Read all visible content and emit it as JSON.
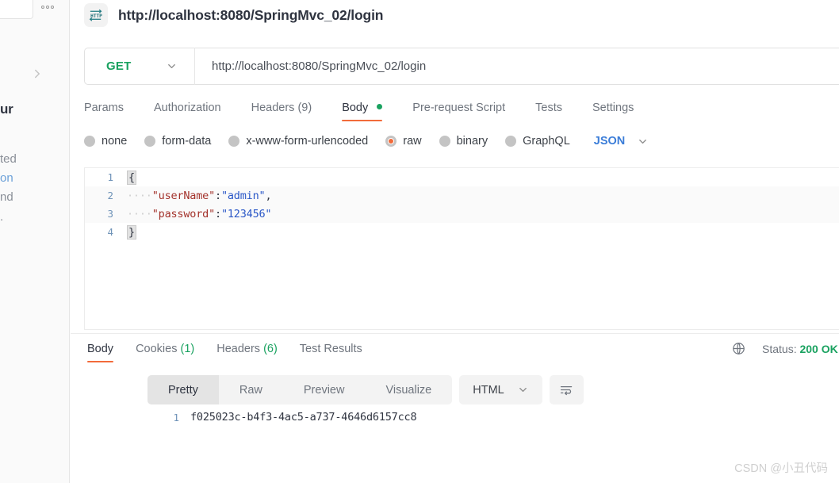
{
  "sidebar": {
    "more_icon": "more-horizontal-icon",
    "expand_icon": "chevron-right-icon",
    "clipped_fragments": {
      "heading": "ur",
      "line1": "ted",
      "line2": "on",
      "line3": "nd",
      "line4": "."
    }
  },
  "request": {
    "icon": "http-protocol-icon",
    "title": "http://localhost:8080/SpringMvc_02/login",
    "method": "GET",
    "url": "http://localhost:8080/SpringMvc_02/login",
    "method_chevron_icon": "chevron-down-icon"
  },
  "request_tabs": [
    {
      "label": "Params",
      "active": false,
      "badge": ""
    },
    {
      "label": "Authorization",
      "active": false,
      "badge": ""
    },
    {
      "label": "Headers",
      "active": false,
      "badge": "(9)"
    },
    {
      "label": "Body",
      "active": true,
      "badge": "",
      "dot": true
    },
    {
      "label": "Pre-request Script",
      "active": false,
      "badge": ""
    },
    {
      "label": "Tests",
      "active": false,
      "badge": ""
    },
    {
      "label": "Settings",
      "active": false,
      "badge": ""
    }
  ],
  "body_types": [
    {
      "label": "none",
      "selected": false
    },
    {
      "label": "form-data",
      "selected": false
    },
    {
      "label": "x-www-form-urlencoded",
      "selected": false
    },
    {
      "label": "raw",
      "selected": true
    },
    {
      "label": "binary",
      "selected": false
    },
    {
      "label": "GraphQL",
      "selected": false
    }
  ],
  "body_format": {
    "label": "JSON",
    "chevron_icon": "chevron-down-icon"
  },
  "editor": {
    "lines": [
      {
        "num": "1",
        "open_brace": "{"
      },
      {
        "num": "2",
        "indent": "····",
        "key": "\"userName\"",
        "colon": ":",
        "value": "\"admin\"",
        "comma": ","
      },
      {
        "num": "3",
        "indent": "····",
        "key": "\"password\"",
        "colon": ":",
        "value": "\"123456\"",
        "comma": ""
      },
      {
        "num": "4",
        "close_brace": "}"
      }
    ]
  },
  "response_tabs": [
    {
      "label": "Body",
      "active": true,
      "badge": ""
    },
    {
      "label": "Cookies",
      "active": false,
      "badge": "(1)"
    },
    {
      "label": "Headers",
      "active": false,
      "badge": "(6)"
    },
    {
      "label": "Test Results",
      "active": false,
      "badge": ""
    }
  ],
  "response_status": {
    "globe_icon": "globe-icon",
    "prefix": "Status: ",
    "code": "200 OK"
  },
  "view_modes": [
    {
      "label": "Pretty",
      "selected": true
    },
    {
      "label": "Raw",
      "selected": false
    },
    {
      "label": "Preview",
      "selected": false
    },
    {
      "label": "Visualize",
      "selected": false
    }
  ],
  "response_type": {
    "label": "HTML",
    "chevron_icon": "chevron-down-icon"
  },
  "wrap_toggle_icon": "word-wrap-icon",
  "response_body": {
    "line_number": "1",
    "value": "f025023c-b4f3-4ac5-a737-4646d6157cc8"
  },
  "watermark": "CSDN @小丑代码",
  "colors": {
    "accent_orange": "#f26b3a",
    "method_green": "#1aa260",
    "json_blue": "#3b7dd8",
    "key_maroon": "#a3322b",
    "value_blue": "#2a57c7",
    "text_dark": "#2f3440",
    "text_muted": "#6f757e"
  }
}
